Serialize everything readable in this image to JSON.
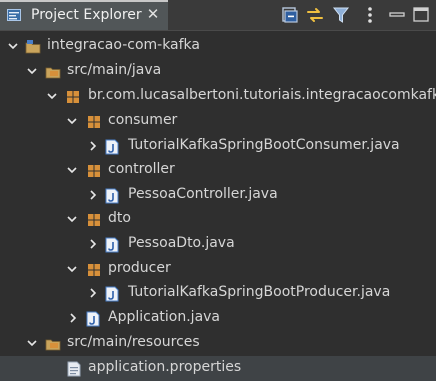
{
  "tab": {
    "title": "Project Explorer",
    "close_glyph": "✕",
    "icon": "project-explorer-icon"
  },
  "toolbar": {
    "collapse_all_icon": "collapse-all-icon",
    "link_editor_icon": "link-with-editor-icon",
    "filter_icon": "filter-icon",
    "view_menu_icon": "view-menu-icon",
    "minimize_icon": "minimize-icon",
    "maximize_icon": "maximize-icon"
  },
  "tree": {
    "project": "integracao-com-kafka",
    "src_main_java": "src/main/java",
    "base_package": "br.com.lucasalbertoni.tutoriais.integracaocomkafka",
    "pkg_consumer": "consumer",
    "file_consumer": "TutorialKafkaSpringBootConsumer.java",
    "pkg_controller": "controller",
    "file_controller": "PessoaController.java",
    "pkg_dto": "dto",
    "file_dto": "PessoaDto.java",
    "pkg_producer": "producer",
    "file_producer": "TutorialKafkaSpringBootProducer.java",
    "file_application": "Application.java",
    "src_main_resources": "src/main/resources",
    "file_properties": "application.properties"
  },
  "colors": {
    "background": "#2f2f2f",
    "tab_active": "#515658",
    "text": "#d6d6d6",
    "package_icon": "#d7903a",
    "java_file_icon": "#4a7fc8",
    "folder_icon": "#c9a45c",
    "toolbar_accent": "#f0c040"
  }
}
